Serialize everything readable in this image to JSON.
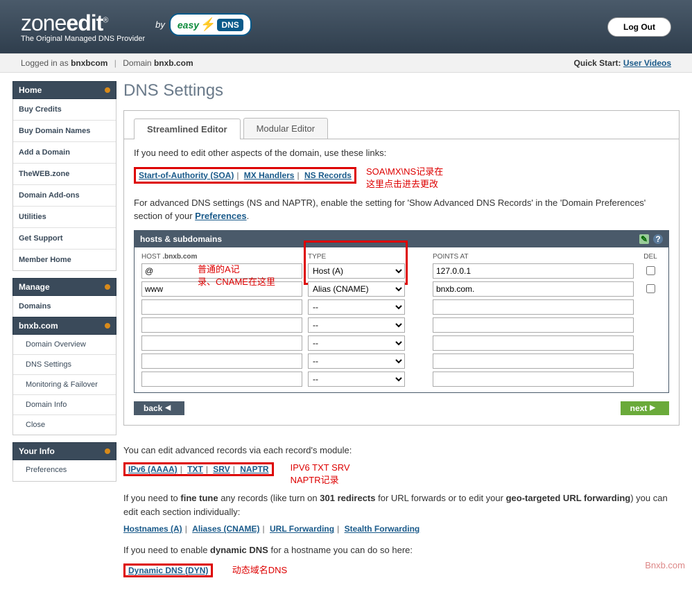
{
  "header": {
    "logo_zone": "zone",
    "logo_edit": "edit",
    "logo_reg": "®",
    "tagline": "The Original Managed DNS Provider",
    "by": "by",
    "easy": "easy",
    "dns_badge": "DNS",
    "logout": "Log Out"
  },
  "status": {
    "logged_in": "Logged in as",
    "user": "bnxbcom",
    "domain_label": "Domain",
    "domain": "bnxb.com",
    "quick_label": "Quick Start:",
    "quick_link": "User Videos"
  },
  "sidebar": {
    "home": "Home",
    "home_items": [
      "Buy Credits",
      "Buy Domain Names",
      "Add a Domain",
      "TheWEB.zone",
      "Domain Add-ons",
      "Utilities",
      "Get Support",
      "Member Home"
    ],
    "manage": "Manage",
    "manage_items": [
      "Domains"
    ],
    "domain_section": "bnxb.com",
    "domain_items": [
      "Domain Overview",
      "DNS Settings",
      "Monitoring & Failover",
      "Domain Info",
      "Close"
    ],
    "your_info": "Your Info",
    "your_info_items": [
      "Preferences"
    ]
  },
  "main": {
    "title": "DNS Settings",
    "tabs": [
      "Streamlined Editor",
      "Modular Editor"
    ],
    "line1": "If you need to edit other aspects of the domain, use these links:",
    "links1": [
      "Start-of-Authority (SOA)",
      "MX Handlers",
      "NS Records"
    ],
    "annot1_line1": "SOA\\MX\\NS记录在",
    "annot1_line2": "这里点击进去更改",
    "line2a": "For advanced DNS settings (NS and NAPTR), enable the setting for 'Show Advanced DNS Records' in the 'Domain Preferences' section of your ",
    "line2_link": "Preferences",
    "line2b": ".",
    "records": {
      "header": "hosts & subdomains",
      "host_label": "HOST",
      "host_suffix": ".bnxb.com",
      "type_label": "TYPE",
      "points_label": "POINTS AT",
      "del_label": "DEL",
      "rows": [
        {
          "host": "@",
          "type": "Host (A)",
          "points": "127.0.0.1",
          "del": false
        },
        {
          "host": "www",
          "type": "Alias (CNAME)",
          "points": "bnxb.com.",
          "del": false
        },
        {
          "host": "",
          "type": "--",
          "points": "",
          "del": null
        },
        {
          "host": "",
          "type": "--",
          "points": "",
          "del": null
        },
        {
          "host": "",
          "type": "--",
          "points": "",
          "del": null
        },
        {
          "host": "",
          "type": "--",
          "points": "",
          "del": null
        },
        {
          "host": "",
          "type": "--",
          "points": "",
          "del": null
        }
      ]
    },
    "annot2_line1": "普通的A记",
    "annot2_line2": "录、CNAME在这里",
    "back": "back",
    "next": "next",
    "line3": "You can edit advanced records via each record's module:",
    "links3": [
      "IPv6 (AAAA)",
      "TXT",
      "SRV",
      "NAPTR"
    ],
    "annot3_line1": "IPV6  TXT SRV",
    "annot3_line2": "NAPTR记录",
    "line4a": "If you need to ",
    "line4b": "fine tune",
    "line4c": " any records (like turn on ",
    "line4d": "301 redirects",
    "line4e": " for URL forwards or to edit your ",
    "line4f": "geo-targeted URL forwarding",
    "line4g": ") you can edit each section individually:",
    "links4": [
      "Hostnames (A)",
      "Aliases (CNAME)",
      "URL Forwarding",
      "Stealth Forwarding"
    ],
    "line5a": "If you need to enable ",
    "line5b": "dynamic DNS",
    "line5c": " for a hostname you can do so here:",
    "link5": "Dynamic DNS (DYN)",
    "annot5": "动态域名DNS"
  },
  "watermark": "Bnxb.com"
}
